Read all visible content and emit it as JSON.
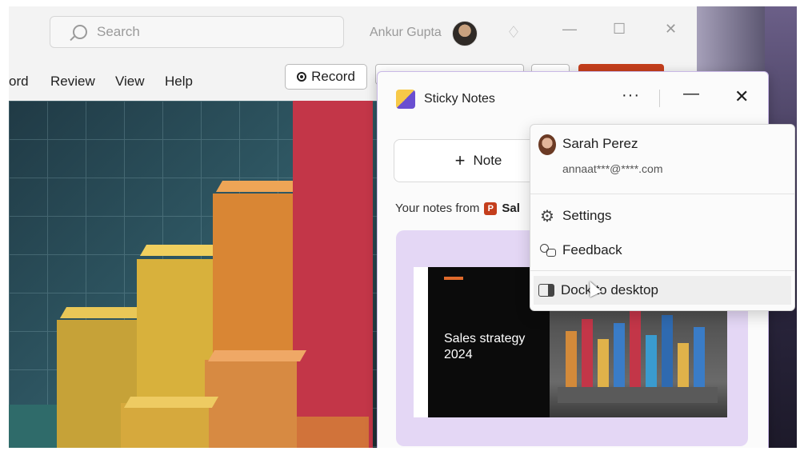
{
  "ppt_window": {
    "search_placeholder": "Search",
    "user_name": "Ankur Gupta",
    "menu": [
      "ord",
      "Review",
      "View",
      "Help"
    ],
    "record_label": "Record",
    "minimize": "—",
    "maximize": "☐",
    "close": "✕"
  },
  "sticky_notes": {
    "title": "Sticky Notes",
    "more": "···",
    "minimize": "—",
    "close": "✕",
    "new_note_label": "Note",
    "notes_from_label": "Your notes from",
    "notes_from_app": "Sal",
    "slide_title": "Sales strategy 2024"
  },
  "account_menu": {
    "name": "Sarah Perez",
    "email": "annaat***@****.com",
    "items": [
      "Settings",
      "Feedback",
      "Dock to desktop"
    ]
  },
  "colors": {
    "accent_powerpoint": "#c43e1c",
    "sticky_card": "#e4d7f5"
  },
  "icons": {
    "search": "search-icon",
    "gem": "gem-icon",
    "record": "record-icon",
    "settings": "gear-icon",
    "feedback": "feedback-icon",
    "dock": "dock-icon"
  }
}
